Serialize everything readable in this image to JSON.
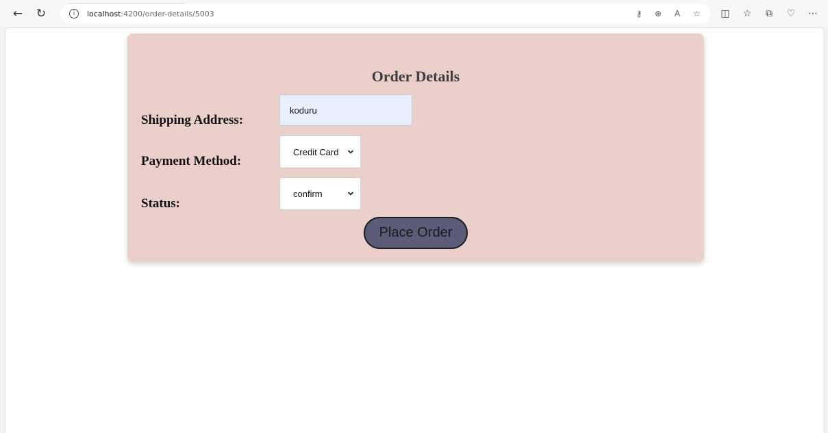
{
  "browser": {
    "url_host": "localhost",
    "url_path": ":4200/order-details/5003"
  },
  "form": {
    "title": "Order Details",
    "shipping_label": "Shipping Address:",
    "shipping_value": "koduru",
    "payment_label": "Payment Method:",
    "payment_selected": "Credit Card",
    "status_label": "Status:",
    "status_selected": "confirm",
    "submit_label": "Place Order"
  },
  "colors": {
    "card_background": "#ebcfcb",
    "address_input_background": "#e8f0fe",
    "button_background": "#5a5c78"
  },
  "icons": {
    "toolbar": [
      "back-arrow-icon",
      "refresh-icon",
      "info-icon",
      "key-icon",
      "zoom-in-icon",
      "read-aloud-icon",
      "favorite-star-icon",
      "split-screen-icon",
      "favorites-icon",
      "collections-icon",
      "browser-essentials-icon",
      "more-options-icon"
    ]
  }
}
